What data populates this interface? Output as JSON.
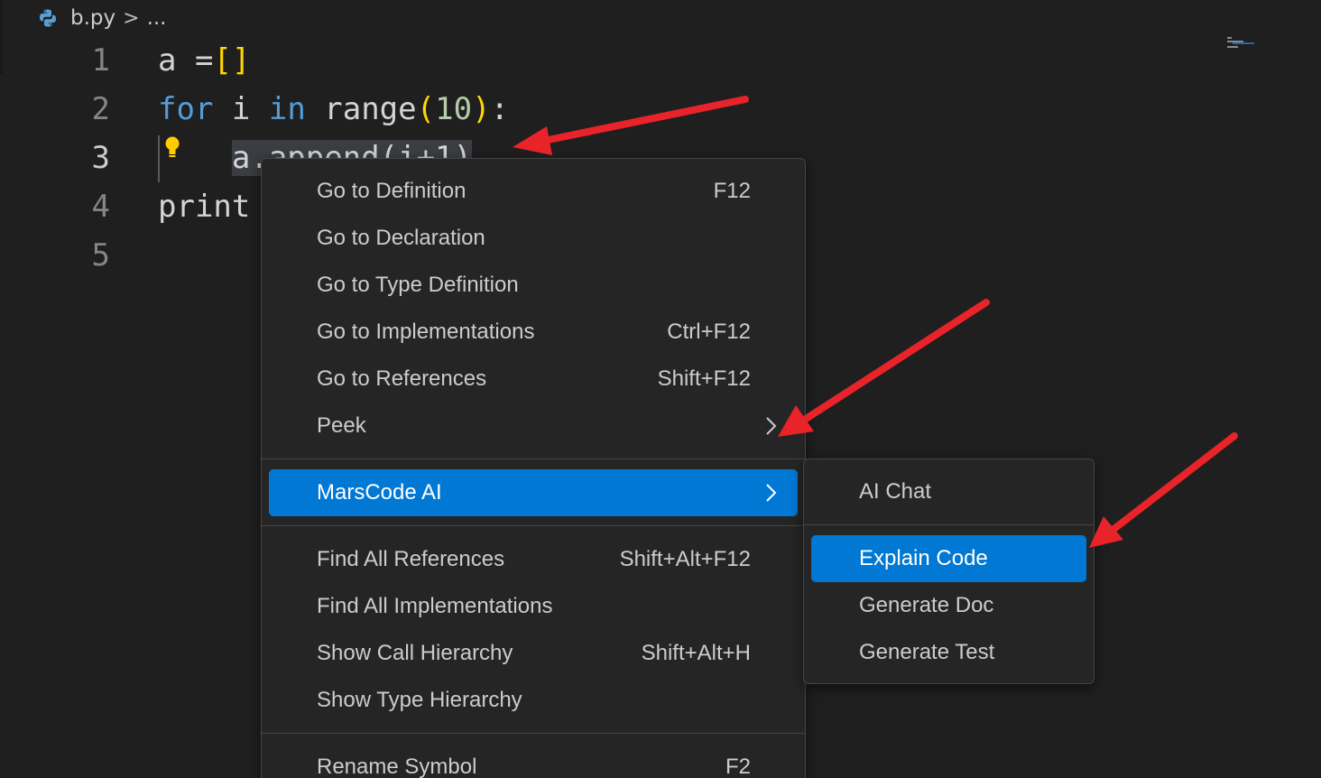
{
  "breadcrumb": {
    "file": "b.py",
    "separator": ">",
    "ellipsis": "..."
  },
  "editor": {
    "lines": [
      {
        "number": "1",
        "tokens": [
          {
            "t": "a ",
            "c": "plain"
          },
          {
            "t": "=",
            "c": "plain"
          },
          {
            "t": "[]",
            "c": "br"
          }
        ]
      },
      {
        "number": "2",
        "tokens": [
          {
            "t": "for",
            "c": "kw"
          },
          {
            "t": " i ",
            "c": "plain"
          },
          {
            "t": "in",
            "c": "kw"
          },
          {
            "t": " range",
            "c": "plain"
          },
          {
            "t": "(",
            "c": "br"
          },
          {
            "t": "10",
            "c": "numlit"
          },
          {
            "t": ")",
            "c": "br"
          },
          {
            "t": ":",
            "c": "plain"
          }
        ]
      },
      {
        "number": "3",
        "tokens": [
          {
            "t": "    ",
            "c": "plain"
          },
          {
            "t": "a.append(i+1)",
            "c": "sel"
          }
        ]
      },
      {
        "number": "4",
        "tokens": [
          {
            "t": "print",
            "c": "plain"
          }
        ]
      },
      {
        "number": "5",
        "tokens": []
      }
    ]
  },
  "context_menu": {
    "groups": [
      [
        {
          "label": "Go to Definition",
          "shortcut": "F12"
        },
        {
          "label": "Go to Declaration",
          "shortcut": ""
        },
        {
          "label": "Go to Type Definition",
          "shortcut": ""
        },
        {
          "label": "Go to Implementations",
          "shortcut": "Ctrl+F12"
        },
        {
          "label": "Go to References",
          "shortcut": "Shift+F12"
        },
        {
          "label": "Peek",
          "shortcut": "",
          "submenu": true
        }
      ],
      [
        {
          "label": "MarsCode AI",
          "shortcut": "",
          "submenu": true,
          "highlighted": true
        }
      ],
      [
        {
          "label": "Find All References",
          "shortcut": "Shift+Alt+F12"
        },
        {
          "label": "Find All Implementations",
          "shortcut": ""
        },
        {
          "label": "Show Call Hierarchy",
          "shortcut": "Shift+Alt+H"
        },
        {
          "label": "Show Type Hierarchy",
          "shortcut": ""
        }
      ],
      [
        {
          "label": "Rename Symbol",
          "shortcut": "F2"
        }
      ]
    ]
  },
  "submenu": {
    "groups": [
      [
        {
          "label": "AI Chat"
        }
      ],
      [
        {
          "label": "Explain Code",
          "highlighted": true
        },
        {
          "label": "Generate Doc"
        },
        {
          "label": "Generate Test"
        }
      ]
    ]
  },
  "colors": {
    "highlight": "#0078d4",
    "arrow": "#e8232a"
  }
}
